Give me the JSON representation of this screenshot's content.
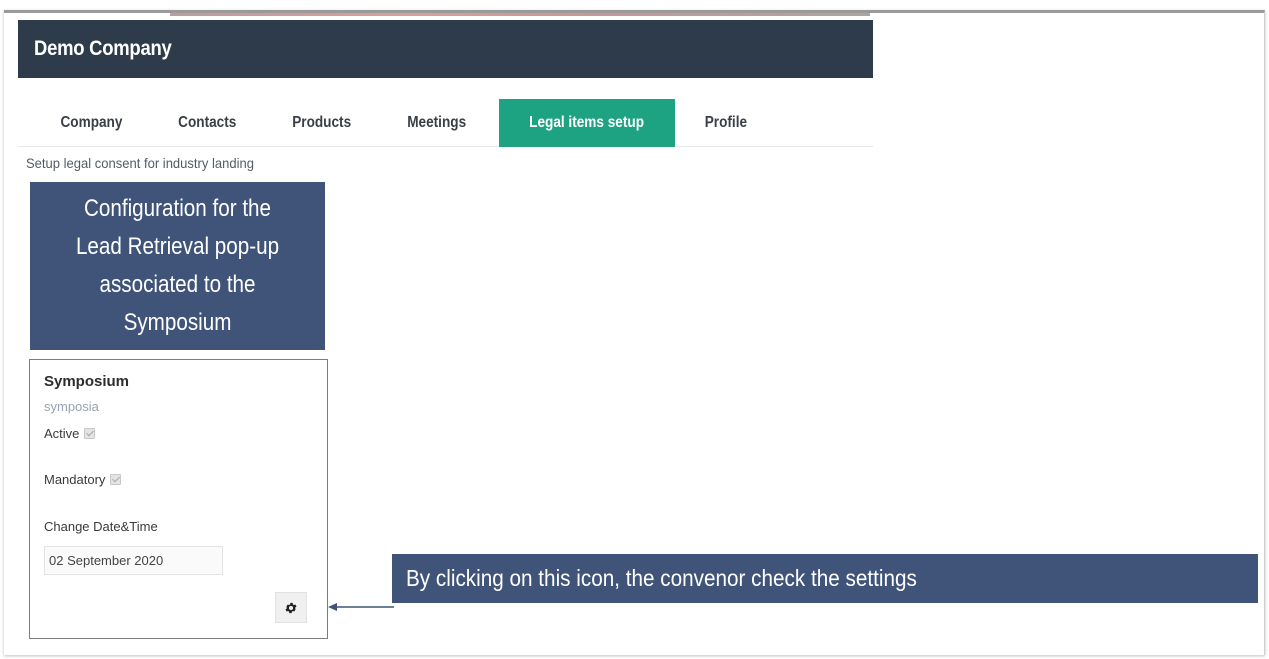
{
  "app": {
    "title": "Demo Company"
  },
  "tabs": [
    {
      "label": "Company",
      "active": false
    },
    {
      "label": "Contacts",
      "active": false
    },
    {
      "label": "Products",
      "active": false
    },
    {
      "label": "Meetings",
      "active": false
    },
    {
      "label": "Legal items setup",
      "active": true
    },
    {
      "label": "Profile",
      "active": false
    }
  ],
  "page": {
    "subtitle": "Setup legal consent for industry landing"
  },
  "callouts": {
    "config": "Configuration for the Lead Retrieval pop-up associated to the Symposium",
    "click": "By clicking on this icon, the convenor check the settings"
  },
  "card": {
    "title": "Symposium",
    "subtitle": "symposia",
    "active_label": "Active",
    "active_checked": true,
    "mandatory_label": "Mandatory",
    "mandatory_checked": true,
    "change_label": "Change Date&Time",
    "date_value": "02 September 2020",
    "settings_icon": "gear-icon"
  },
  "colors": {
    "header_bg": "#2e3b4a",
    "active_tab": "#1ea382",
    "callout_bg": "#3f5478"
  }
}
